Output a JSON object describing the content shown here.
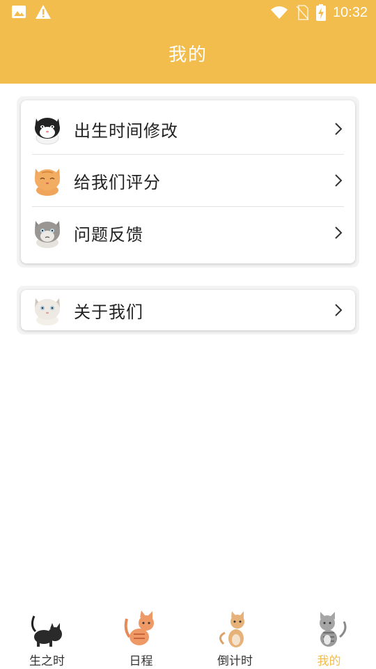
{
  "status_bar": {
    "time": "10:32",
    "icons": [
      "image-icon",
      "warning-icon",
      "wifi-icon",
      "no-sim-icon",
      "battery-charging-icon"
    ]
  },
  "header": {
    "title": "我的"
  },
  "menu_group_1": {
    "items": [
      {
        "label": "出生时间修改",
        "icon": "black-white-cat-avatar-icon"
      },
      {
        "label": "给我们评分",
        "icon": "orange-cat-avatar-icon"
      },
      {
        "label": "问题反馈",
        "icon": "gray-cat-avatar-icon"
      }
    ]
  },
  "menu_group_2": {
    "items": [
      {
        "label": "关于我们",
        "icon": "white-cat-avatar-icon"
      }
    ]
  },
  "bottom_nav": {
    "items": [
      {
        "label": "生之时",
        "icon": "black-cat-icon",
        "active": false
      },
      {
        "label": "日程",
        "icon": "orange-cat-icon",
        "active": false
      },
      {
        "label": "倒计时",
        "icon": "beige-cat-icon",
        "active": false
      },
      {
        "label": "我的",
        "icon": "gray-cat-icon",
        "active": true
      }
    ]
  },
  "colors": {
    "accent": "#f2bd4c",
    "text": "#222222",
    "divider": "#e2e2e2"
  }
}
